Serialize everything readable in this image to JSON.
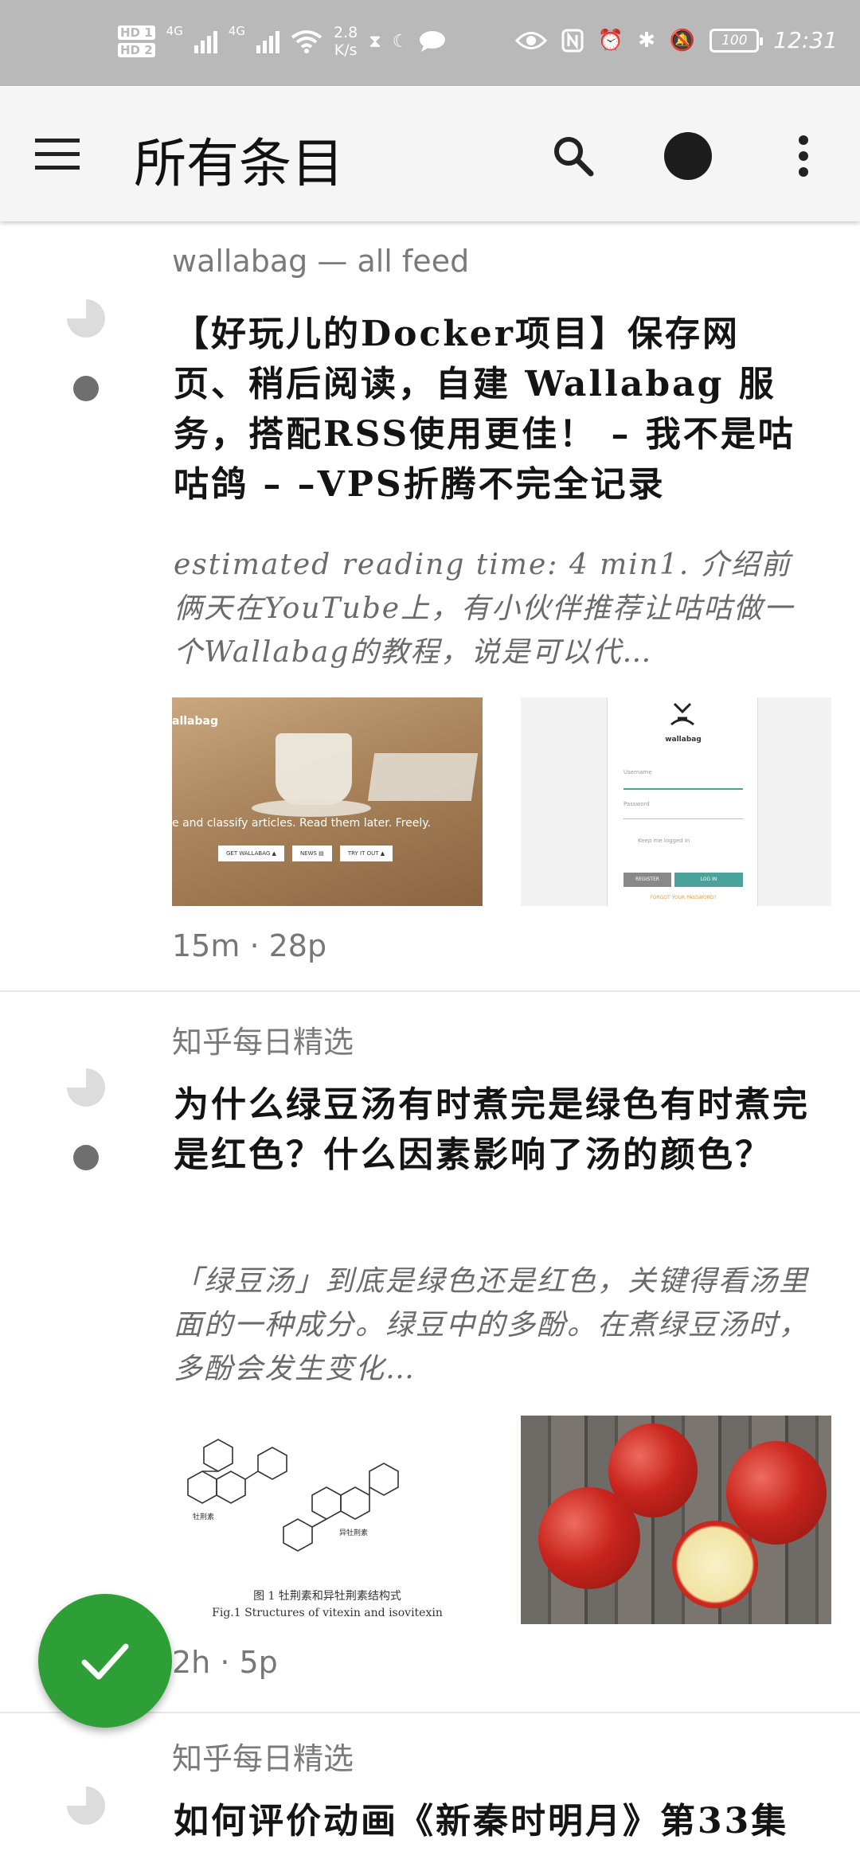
{
  "status_bar": {
    "hd1": "HD 1",
    "hd2": "HD 2",
    "net1": "4G",
    "net2": "4G",
    "speed_value": "2.8",
    "speed_unit": "K/s",
    "battery": "100",
    "time": "12:31"
  },
  "app_bar": {
    "title": "所有条目",
    "icons": [
      "menu-icon",
      "search-icon",
      "avatar",
      "more-icon"
    ]
  },
  "entries": [
    {
      "feed": "wallabag — all feed",
      "title": "【好玩儿的Docker项目】保存网页、稍后阅读，自建 Wallabag 服务，搭配RSS使用更佳！ – 我不是咕咕鸽 – –VPS折腾不完全记录",
      "excerpt": "estimated reading time: 4 min1. 介绍前俩天在YouTube上，有小伙伴推荐让咕咕做一个Wallabag的教程，说是可以代…",
      "meta": "15m · 28p",
      "thumb1": {
        "brand": "allabag",
        "tagline": "e and classify articles. Read them later. Freely.",
        "buttons": [
          "GET WALLABAG ▲",
          "NEWS ▤",
          "TRY IT OUT ▲"
        ]
      },
      "thumb2": {
        "logo_text": "wallabag",
        "username_label": "Username",
        "password_label": "Password",
        "remember_label": "Keep me logged in",
        "register_label": "REGISTER",
        "login_label": "LOG IN",
        "forgot_label": "FORGOT YOUR PASSWORD?"
      }
    },
    {
      "feed": "知乎每日精选",
      "title": "为什么绿豆汤有时煮完是绿色有时煮完是红色？什么因素影响了汤的颜色？",
      "excerpt": "「绿豆汤」到底是绿色还是红色，关键得看汤里面的一种成分。绿豆中的多酚。在煮绿豆汤时，多酚会发生变化…",
      "meta": "2h · 5p",
      "thumb1": {
        "caption_cn": "图 1    牡荆素和异牡荆素结构式",
        "caption_en": "Fig.1    Structures of vitexin and isovitexin",
        "label_left": "牡荆素",
        "label_right": "异牡荆素"
      }
    },
    {
      "feed": "知乎每日精选",
      "title": "如何评价动画《新秦时明月》第33集"
    }
  ],
  "fab": {
    "icon": "check-icon",
    "color": "#2e9e36"
  },
  "colors": {
    "status_bar": "#b9b9b9",
    "app_bar": "#f5f5f5",
    "accent": "#2e9e36"
  }
}
